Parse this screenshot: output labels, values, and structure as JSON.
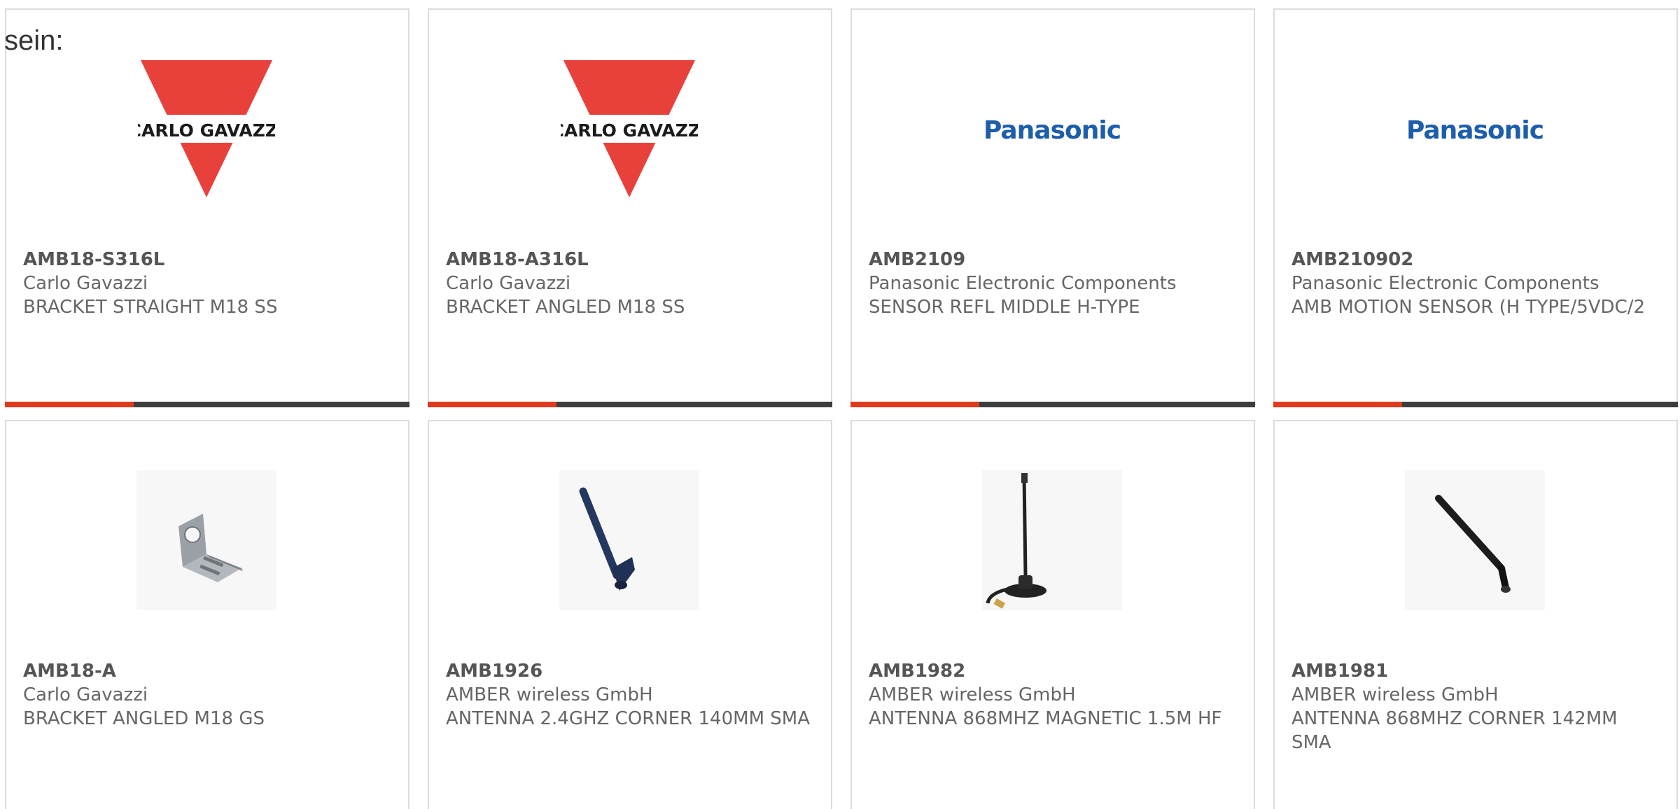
{
  "intro_text": "sein:",
  "colors": {
    "accent": "#e03a1e",
    "bar": "#3d3d3d",
    "gavazzi_red": "#e8413b",
    "panasonic_blue": "#1d5eab"
  },
  "products": [
    {
      "part": "AMB18-S316L",
      "manufacturer": "Carlo Gavazzi",
      "description": "BRACKET STRAIGHT M18 SS",
      "image": "carlo-gavazzi-logo",
      "logo_text": "CARLO GAVAZZI"
    },
    {
      "part": "AMB18-A316L",
      "manufacturer": "Carlo Gavazzi",
      "description": "BRACKET ANGLED M18 SS",
      "image": "carlo-gavazzi-logo",
      "logo_text": "CARLO GAVAZZI"
    },
    {
      "part": "AMB2109",
      "manufacturer": "Panasonic Electronic Components",
      "description": "SENSOR REFL MIDDLE H-TYPE",
      "image": "panasonic-logo",
      "logo_text": "Panasonic"
    },
    {
      "part": "AMB210902",
      "manufacturer": "Panasonic Electronic Components",
      "description": "AMB MOTION SENSOR (H TYPE/5VDC/2",
      "image": "panasonic-logo",
      "logo_text": "Panasonic"
    },
    {
      "part": "AMB18-A",
      "manufacturer": "Carlo Gavazzi",
      "description": "BRACKET ANGLED M18 GS",
      "image": "bracket-photo"
    },
    {
      "part": "AMB1926",
      "manufacturer": "AMBER wireless GmbH",
      "description": "ANTENNA 2.4GHZ CORNER 140MM SMA",
      "image": "blue-antenna-photo"
    },
    {
      "part": "AMB1982",
      "manufacturer": "AMBER wireless GmbH",
      "description": "ANTENNA 868MHZ MAGNETIC 1.5M HF",
      "image": "magnetic-antenna-photo"
    },
    {
      "part": "AMB1981",
      "manufacturer": "AMBER wireless GmbH",
      "description": "ANTENNA 868MHZ CORNER 142MM SMA",
      "image": "black-antenna-photo"
    }
  ]
}
